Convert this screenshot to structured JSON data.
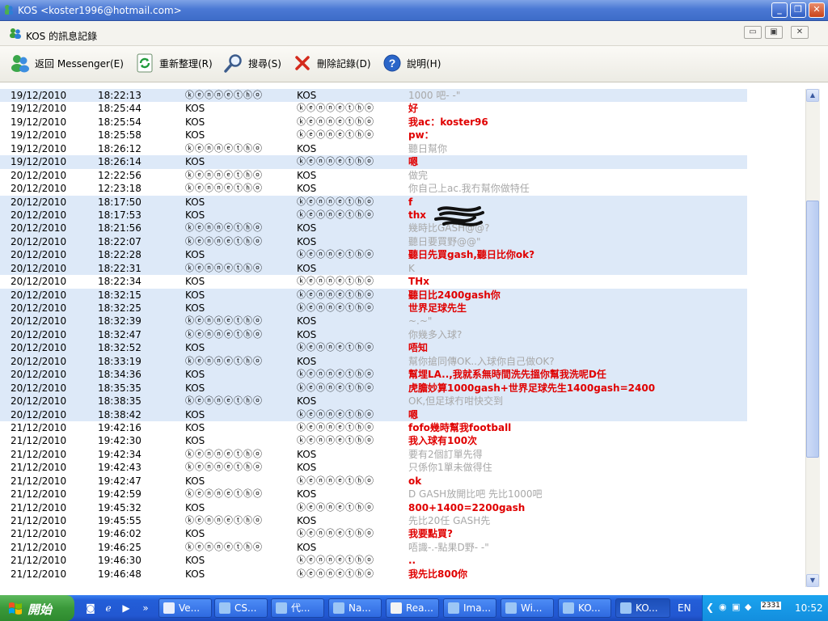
{
  "window": {
    "title": "KOS <koster1996@hotmail.com>"
  },
  "subwindow": {
    "title": "KOS 的訊息記錄"
  },
  "toolbar": {
    "back": "返回 Messenger(E)",
    "refresh": "重新整理(R)",
    "search": "搜尋(S)",
    "delete": "刪除記錄(D)",
    "help": "說明(H)"
  },
  "colors": {
    "titlebar": "#3d6cc8",
    "row_alt": "#dde9f8",
    "msg_red": "#e00000",
    "msg_gray": "#a8a8a8"
  },
  "messages": [
    {
      "date": "19/12/2010",
      "time": "18:22:13",
      "from": "ⓚⓔⓝⓝⓔⓣⓗⓞ",
      "to": "KOS",
      "text": "1000 吧- -\"",
      "style": "gray",
      "alt": true
    },
    {
      "date": "19/12/2010",
      "time": "18:25:44",
      "from": "KOS",
      "to": "ⓚⓔⓝⓝⓔⓣⓗⓞ",
      "text": "好",
      "style": "red",
      "alt": false
    },
    {
      "date": "19/12/2010",
      "time": "18:25:54",
      "from": "KOS",
      "to": "ⓚⓔⓝⓝⓔⓣⓗⓞ",
      "text": "我ac：koster96",
      "style": "red",
      "alt": false
    },
    {
      "date": "19/12/2010",
      "time": "18:25:58",
      "from": "KOS",
      "to": "ⓚⓔⓝⓝⓔⓣⓗⓞ",
      "text": "pw：",
      "style": "red",
      "alt": false
    },
    {
      "date": "19/12/2010",
      "time": "18:26:12",
      "from": "ⓚⓔⓝⓝⓔⓣⓗⓞ",
      "to": "KOS",
      "text": "聽日幫你",
      "style": "gray",
      "alt": false
    },
    {
      "date": "19/12/2010",
      "time": "18:26:14",
      "from": "KOS",
      "to": "ⓚⓔⓝⓝⓔⓣⓗⓞ",
      "text": "嗯",
      "style": "red",
      "alt": true
    },
    {
      "date": "20/12/2010",
      "time": "12:22:56",
      "from": "ⓚⓔⓝⓝⓔⓣⓗⓞ",
      "to": "KOS",
      "text": "做完",
      "style": "gray",
      "alt": false
    },
    {
      "date": "20/12/2010",
      "time": "12:23:18",
      "from": "ⓚⓔⓝⓝⓔⓣⓗⓞ",
      "to": "KOS",
      "text": "你自己上ac.我冇幫你做特任",
      "style": "gray",
      "alt": false
    },
    {
      "date": "20/12/2010",
      "time": "18:17:50",
      "from": "KOS",
      "to": "ⓚⓔⓝⓝⓔⓣⓗⓞ",
      "text": "f",
      "style": "red",
      "alt": true
    },
    {
      "date": "20/12/2010",
      "time": "18:17:53",
      "from": "KOS",
      "to": "ⓚⓔⓝⓝⓔⓣⓗⓞ",
      "text": "thx",
      "style": "red",
      "alt": true
    },
    {
      "date": "20/12/2010",
      "time": "18:21:56",
      "from": "ⓚⓔⓝⓝⓔⓣⓗⓞ",
      "to": "KOS",
      "text": "幾時比GASH@@?",
      "style": "gray",
      "alt": true
    },
    {
      "date": "20/12/2010",
      "time": "18:22:07",
      "from": "ⓚⓔⓝⓝⓔⓣⓗⓞ",
      "to": "KOS",
      "text": "聽日要買野@@\"",
      "style": "gray",
      "alt": true
    },
    {
      "date": "20/12/2010",
      "time": "18:22:28",
      "from": "KOS",
      "to": "ⓚⓔⓝⓝⓔⓣⓗⓞ",
      "text": "聽日先買gash,聽日比你ok?",
      "style": "red",
      "alt": true
    },
    {
      "date": "20/12/2010",
      "time": "18:22:31",
      "from": "ⓚⓔⓝⓝⓔⓣⓗⓞ",
      "to": "KOS",
      "text": "K",
      "style": "gray",
      "alt": true
    },
    {
      "date": "20/12/2010",
      "time": "18:22:34",
      "from": "KOS",
      "to": "ⓚⓔⓝⓝⓔⓣⓗⓞ",
      "text": "THx",
      "style": "red",
      "alt": false
    },
    {
      "date": "20/12/2010",
      "time": "18:32:15",
      "from": "KOS",
      "to": "ⓚⓔⓝⓝⓔⓣⓗⓞ",
      "text": "聽日比2400gash你",
      "style": "red",
      "alt": true
    },
    {
      "date": "20/12/2010",
      "time": "18:32:25",
      "from": "KOS",
      "to": "ⓚⓔⓝⓝⓔⓣⓗⓞ",
      "text": "世界足球先生",
      "style": "red",
      "alt": true
    },
    {
      "date": "20/12/2010",
      "time": "18:32:39",
      "from": "ⓚⓔⓝⓝⓔⓣⓗⓞ",
      "to": "KOS",
      "text": "~.~\"",
      "style": "gray",
      "alt": true
    },
    {
      "date": "20/12/2010",
      "time": "18:32:47",
      "from": "ⓚⓔⓝⓝⓔⓣⓗⓞ",
      "to": "KOS",
      "text": "你幾多入球?",
      "style": "gray",
      "alt": true
    },
    {
      "date": "20/12/2010",
      "time": "18:32:52",
      "from": "KOS",
      "to": "ⓚⓔⓝⓝⓔⓣⓗⓞ",
      "text": "唔知",
      "style": "red",
      "alt": true
    },
    {
      "date": "20/12/2010",
      "time": "18:33:19",
      "from": "ⓚⓔⓝⓝⓔⓣⓗⓞ",
      "to": "KOS",
      "text": "幫你搶同傳OK..入球你自己做OK?",
      "style": "gray",
      "alt": true
    },
    {
      "date": "20/12/2010",
      "time": "18:34:36",
      "from": "KOS",
      "to": "ⓚⓔⓝⓝⓔⓣⓗⓞ",
      "text": "幫埋LA..,我就系無時間洗先搵你幫我洗呢D任",
      "style": "red",
      "alt": true
    },
    {
      "date": "20/12/2010",
      "time": "18:35:35",
      "from": "KOS",
      "to": "ⓚⓔⓝⓝⓔⓣⓗⓞ",
      "text": "虎膽妙算1000gash+世界足球先生1400gash=2400",
      "style": "red",
      "alt": true
    },
    {
      "date": "20/12/2010",
      "time": "18:38:35",
      "from": "ⓚⓔⓝⓝⓔⓣⓗⓞ",
      "to": "KOS",
      "text": "OK,但足球冇咁快交到",
      "style": "gray",
      "alt": true
    },
    {
      "date": "20/12/2010",
      "time": "18:38:42",
      "from": "KOS",
      "to": "ⓚⓔⓝⓝⓔⓣⓗⓞ",
      "text": "嗯",
      "style": "red",
      "alt": true
    },
    {
      "date": "21/12/2010",
      "time": "19:42:16",
      "from": "KOS",
      "to": "ⓚⓔⓝⓝⓔⓣⓗⓞ",
      "text": "fofo幾時幫我football",
      "style": "red",
      "alt": false
    },
    {
      "date": "21/12/2010",
      "time": "19:42:30",
      "from": "KOS",
      "to": "ⓚⓔⓝⓝⓔⓣⓗⓞ",
      "text": "我入球有100次",
      "style": "red",
      "alt": false
    },
    {
      "date": "21/12/2010",
      "time": "19:42:34",
      "from": "ⓚⓔⓝⓝⓔⓣⓗⓞ",
      "to": "KOS",
      "text": "要有2個訂單先得",
      "style": "gray",
      "alt": false
    },
    {
      "date": "21/12/2010",
      "time": "19:42:43",
      "from": "ⓚⓔⓝⓝⓔⓣⓗⓞ",
      "to": "KOS",
      "text": "只係你1單未做得住",
      "style": "gray",
      "alt": false
    },
    {
      "date": "21/12/2010",
      "time": "19:42:47",
      "from": "KOS",
      "to": "ⓚⓔⓝⓝⓔⓣⓗⓞ",
      "text": "ok",
      "style": "red",
      "alt": false
    },
    {
      "date": "21/12/2010",
      "time": "19:42:59",
      "from": "ⓚⓔⓝⓝⓔⓣⓗⓞ",
      "to": "KOS",
      "text": "D GASH放開比吧 先比1000吧",
      "style": "gray",
      "alt": false
    },
    {
      "date": "21/12/2010",
      "time": "19:45:32",
      "from": "KOS",
      "to": "ⓚⓔⓝⓝⓔⓣⓗⓞ",
      "text": "800+1400=2200gash",
      "style": "red",
      "alt": false
    },
    {
      "date": "21/12/2010",
      "time": "19:45:55",
      "from": "ⓚⓔⓝⓝⓔⓣⓗⓞ",
      "to": "KOS",
      "text": "先比20任 GASH先",
      "style": "gray",
      "alt": false
    },
    {
      "date": "21/12/2010",
      "time": "19:46:02",
      "from": "KOS",
      "to": "ⓚⓔⓝⓝⓔⓣⓗⓞ",
      "text": "我要點買?",
      "style": "red",
      "alt": false
    },
    {
      "date": "21/12/2010",
      "time": "19:46:25",
      "from": "ⓚⓔⓝⓝⓔⓣⓗⓞ",
      "to": "KOS",
      "text": "唔識-.-點果D野- -\"",
      "style": "gray",
      "alt": false
    },
    {
      "date": "21/12/2010",
      "time": "19:46:30",
      "from": "KOS",
      "to": "ⓚⓔⓝⓝⓔⓣⓗⓞ",
      "text": "..",
      "style": "red",
      "alt": false
    },
    {
      "date": "21/12/2010",
      "time": "19:46:48",
      "from": "KOS",
      "to": "ⓚⓔⓝⓝⓔⓣⓗⓞ",
      "text": "我先比800你",
      "style": "red",
      "alt": false
    }
  ],
  "taskbar": {
    "start": "開始",
    "tasks": [
      {
        "label": "Ve...",
        "icon": "msn-icon",
        "active": false
      },
      {
        "label": "CS...",
        "icon": "ie-icon",
        "active": false
      },
      {
        "label": "代...",
        "icon": "ie-icon",
        "active": false
      },
      {
        "label": "Na...",
        "icon": "ie-icon",
        "active": false
      },
      {
        "label": "Rea...",
        "icon": "document-icon",
        "active": false
      },
      {
        "label": "Ima...",
        "icon": "ie-icon",
        "active": false
      },
      {
        "label": "Wi...",
        "icon": "messenger-icon",
        "active": false
      },
      {
        "label": "KO...",
        "icon": "messenger-icon",
        "active": false
      },
      {
        "label": "KO...",
        "icon": "messenger-icon",
        "active": true
      }
    ],
    "language": "EN",
    "clock": "10:52",
    "tray_badge": "2331"
  }
}
